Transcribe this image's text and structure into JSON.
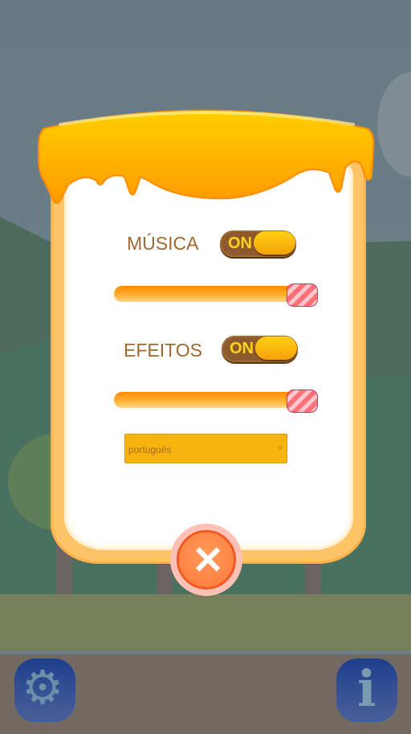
{
  "settings": {
    "music": {
      "label": "MÚSICA",
      "toggle": "ON",
      "volume_percent": 100
    },
    "effects": {
      "label": "EFEITOS",
      "toggle": "ON",
      "volume_percent": 100
    },
    "language": {
      "selected": "português"
    }
  },
  "colors": {
    "panel": "#ffc466",
    "drip": "#ffb300",
    "toggle": "#8d5a2c",
    "accent": "#ff7a3a"
  }
}
